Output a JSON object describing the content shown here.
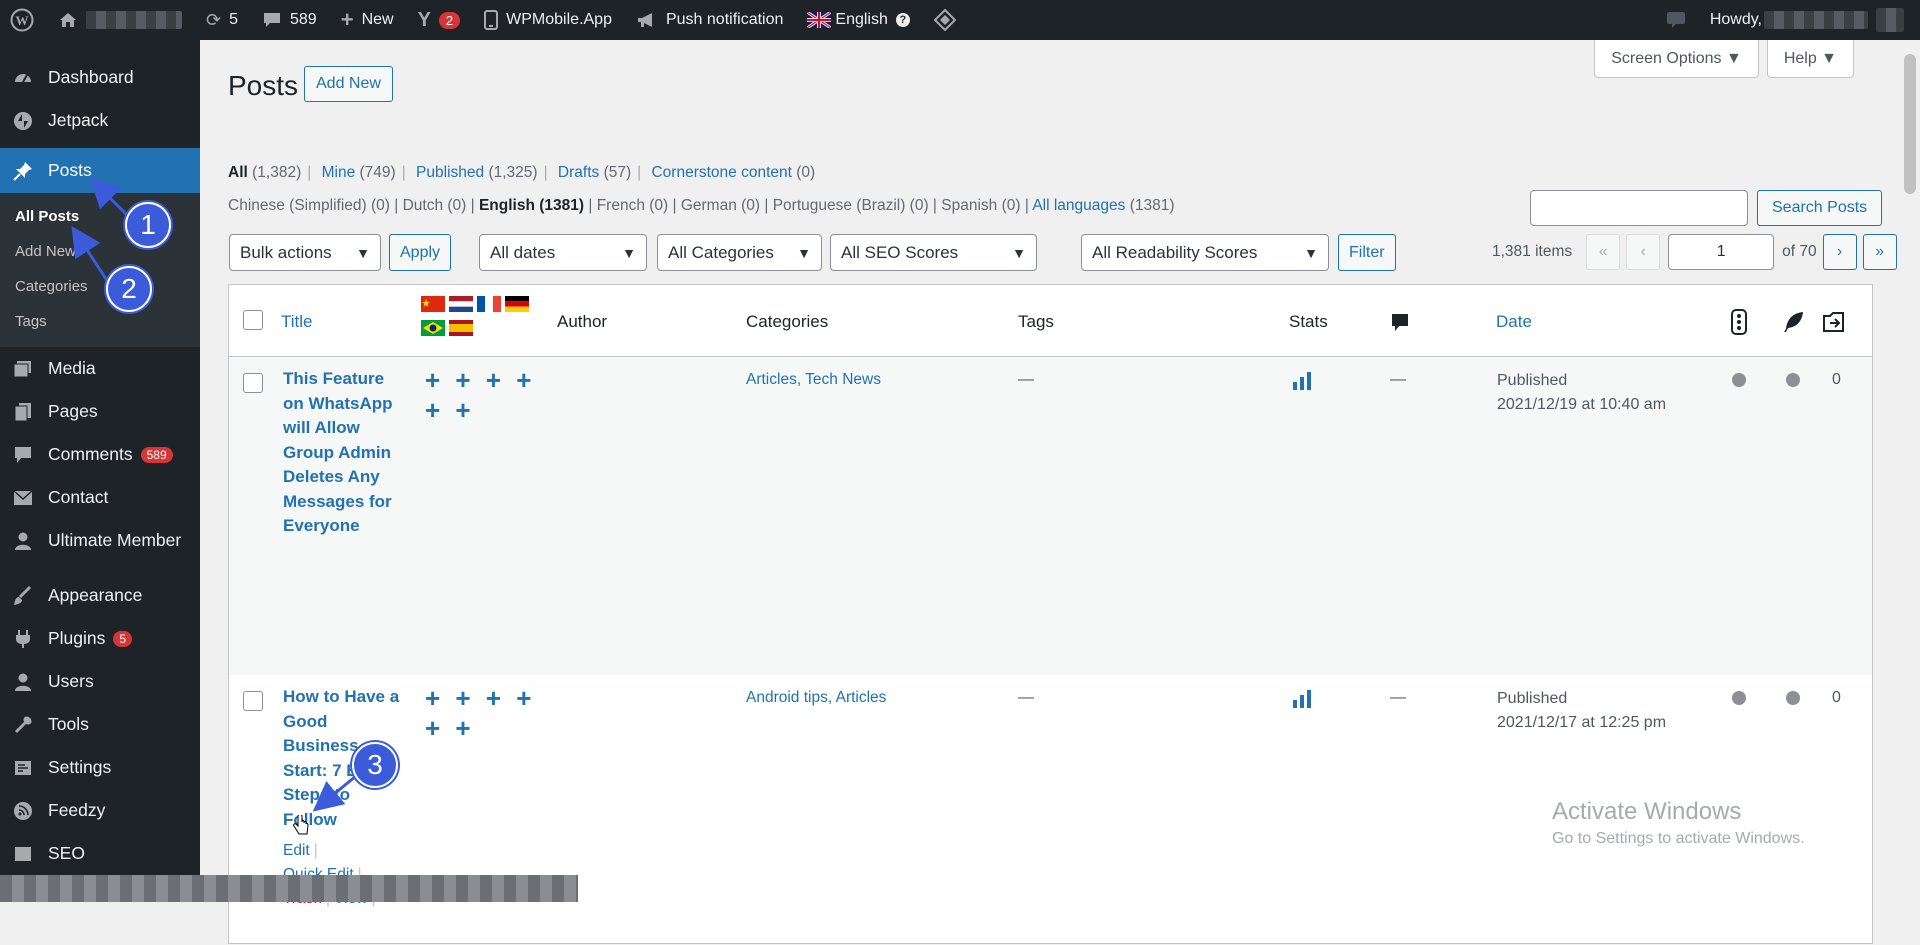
{
  "admin_bar": {
    "updates_count": "5",
    "comments_count": "589",
    "new_label": "New",
    "yoast_badge": "2",
    "wpmobile_label": "WPMobile.App",
    "push_label": "Push notification",
    "language_label": "English",
    "howdy_label": "Howdy,"
  },
  "sidebar": {
    "items": [
      {
        "label": "Dashboard",
        "icon": "dashboard-icon"
      },
      {
        "label": "Jetpack",
        "icon": "jetpack-icon"
      },
      {
        "label": "Posts",
        "icon": "pin-icon"
      },
      {
        "label": "Media",
        "icon": "media-icon"
      },
      {
        "label": "Pages",
        "icon": "pages-icon"
      },
      {
        "label": "Comments",
        "icon": "comment-icon",
        "badge": "589"
      },
      {
        "label": "Contact",
        "icon": "envelope-icon"
      },
      {
        "label": "Ultimate Member",
        "icon": "user-icon"
      },
      {
        "label": "Appearance",
        "icon": "brush-icon"
      },
      {
        "label": "Plugins",
        "icon": "plug-icon",
        "badge": "5"
      },
      {
        "label": "Users",
        "icon": "users-icon"
      },
      {
        "label": "Tools",
        "icon": "wrench-icon"
      },
      {
        "label": "Settings",
        "icon": "settings-icon"
      },
      {
        "label": "Feedzy",
        "icon": "feed-icon"
      },
      {
        "label": "SEO",
        "icon": "seo-icon"
      }
    ],
    "posts_submenu": [
      "All Posts",
      "Add New",
      "Categories",
      "Tags"
    ]
  },
  "screen_meta": {
    "screen_options": "Screen Options ▼",
    "help": "Help ▼"
  },
  "page": {
    "title": "Posts",
    "add_new": "Add New",
    "views": [
      {
        "label": "All",
        "count": "(1,382)"
      },
      {
        "label": "Mine",
        "count": "(749)"
      },
      {
        "label": "Published",
        "count": "(1,325)"
      },
      {
        "label": "Drafts",
        "count": "(57)"
      },
      {
        "label": "Cornerstone content",
        "count": "(0)"
      }
    ],
    "languages": "Chinese (Simplified) (0) | Dutch (0) | ",
    "lang_english": "English (1381)",
    "languages_rest": " | French (0) | German (0) | Portuguese (Brazil) (0) | Spanish (0) | ",
    "lang_all": "All languages",
    "lang_all_count": " (1381)",
    "search_button": "Search Posts"
  },
  "filters": {
    "bulk": "Bulk actions",
    "apply": "Apply",
    "dates": "All dates",
    "categories": "All Categories",
    "seo": "All SEO Scores",
    "readability": "All Readability Scores",
    "filter": "Filter"
  },
  "pagination": {
    "items": "1,381 items",
    "first": "«",
    "prev": "‹",
    "current": "1",
    "of": "of 70",
    "next": "›",
    "last": "»"
  },
  "table": {
    "columns": {
      "title": "Title",
      "author": "Author",
      "categories": "Categories",
      "tags": "Tags",
      "stats": "Stats",
      "date": "Date"
    },
    "rows": [
      {
        "title": "This Feature on WhatsApp will Allow Group Admin Deletes Any Messages for Everyone",
        "plus": "+ + + + + +",
        "categories": "Articles, Tech News",
        "tags": "—",
        "comments": "—",
        "status": "Published",
        "date": "2021/12/19 at 10:40 am",
        "count": "0"
      },
      {
        "title": "How to Have a Good Business Start: 7 Easy Steps to Follow",
        "plus": "+ + + + + +",
        "categories": "Android tips, Articles",
        "tags": "—",
        "comments": "—",
        "status": "Published",
        "date": "2021/12/17 at 12:25 pm",
        "count": "0",
        "actions": {
          "edit": "Edit",
          "quick_edit": "Quick Edit",
          "trash": "Trash",
          "view": "View"
        }
      }
    ]
  },
  "callouts": [
    "1",
    "2",
    "3"
  ],
  "watermark": {
    "line1": "Activate Windows",
    "line2": "Go to Settings to activate Windows."
  }
}
